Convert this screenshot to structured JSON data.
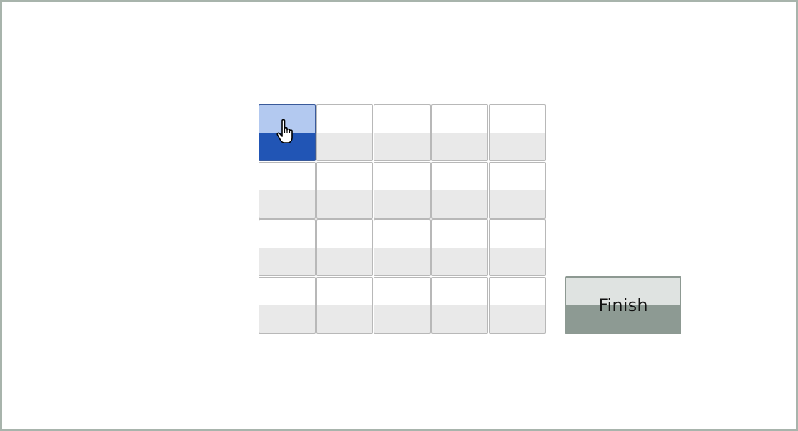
{
  "grid": {
    "rows": 4,
    "columns": 5,
    "selected_cell": {
      "row": 0,
      "col": 0
    },
    "cell_colors": {
      "normal_top": "#ffffff",
      "normal_bottom": "#e9e9e9",
      "selected_top": "#b3c9f0",
      "selected_bottom": "#2155b5"
    }
  },
  "cursor": {
    "icon": "hand-pointer-icon"
  },
  "finish_button": {
    "label": "Finish",
    "top_color": "#dfe3e1",
    "bottom_color": "#8d9a93"
  },
  "frame": {
    "border_color": "#a8b4ac"
  }
}
